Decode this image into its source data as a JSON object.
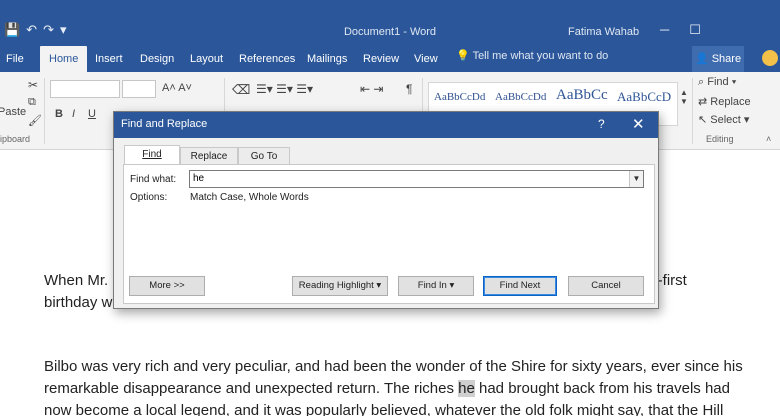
{
  "window": {
    "doc_title": "Document1  -  Word",
    "user": "Fatima Wahab"
  },
  "tabs": [
    "File",
    "Home",
    "Insert",
    "Design",
    "Layout",
    "References",
    "Mailings",
    "Review",
    "View"
  ],
  "tell_me": "Tell me what you want to do",
  "share": "Share",
  "ribbon": {
    "paste": "Paste",
    "clipboard": "lipboard",
    "styles": [
      "AaBbCcDd",
      "AaBbCcDd",
      "AaBbCc",
      "AaBbCcD"
    ],
    "find": "Find",
    "replace": "Replace",
    "select": "Select",
    "editing": "Editing",
    "bold": "B",
    "italic": "I",
    "underline": "U"
  },
  "document": {
    "para1_line1_start": "When Mr.",
    "para1_line1_end": "ty-first",
    "para1_line2_start": "birthday w",
    "para2_line1": "Bilbo was very rich and very peculiar, and had been the wonder of the Shire for sixty years, ever since his",
    "para2_line2_before": "remarkable disappearance and unexpected return. The riches ",
    "para2_line2_hl": "he",
    "para2_line2_after": " had brought back from his travels had",
    "para2_line3": "now become a local legend, and it was popularly believed, whatever the old folk might say, that the Hill"
  },
  "dialog": {
    "title": "Find and Replace",
    "help": "?",
    "close": "✕",
    "tabs": [
      "Find",
      "Replace",
      "Go To"
    ],
    "find_what_label": "Find what:",
    "find_what_value": "he",
    "options_label": "Options:",
    "options_value": "Match Case, Whole Words",
    "buttons": {
      "more": "More >>",
      "reading_highlight": "Reading Highlight ▾",
      "find_in": "Find In ▾",
      "find_next": "Find Next",
      "cancel": "Cancel"
    }
  },
  "colors": {
    "word_blue": "#2b579a",
    "ribbon_bg": "#f3f3f3",
    "dialog_bg": "#f0f0f0"
  }
}
